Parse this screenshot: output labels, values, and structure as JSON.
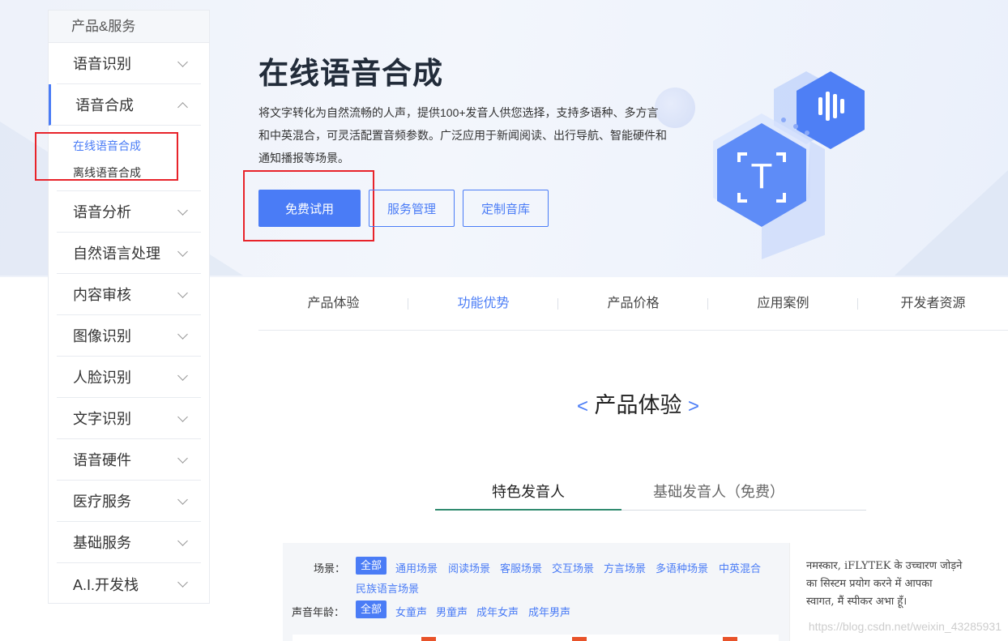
{
  "sidebar": {
    "header": "产品&服务",
    "items_top": [
      {
        "label": "语音识别"
      }
    ],
    "active_item": {
      "label": "语音合成"
    },
    "sub_items": [
      {
        "label": "在线语音合成"
      },
      {
        "label": "离线语音合成"
      }
    ],
    "items_bottom": [
      {
        "label": "语音分析"
      },
      {
        "label": "自然语言处理"
      },
      {
        "label": "内容审核"
      },
      {
        "label": "图像识别"
      },
      {
        "label": "人脸识别"
      },
      {
        "label": "文字识别"
      },
      {
        "label": "语音硬件"
      },
      {
        "label": "医疗服务"
      },
      {
        "label": "基础服务"
      },
      {
        "label": "A.I.开发栈"
      }
    ]
  },
  "hero": {
    "title": "在线语音合成",
    "description": "将文字转化为自然流畅的人声，提供100+发音人供您选择，支持多语种、多方言和中英混合，可灵活配置音频参数。广泛应用于新闻阅读、出行导航、智能硬件和通知播报等场景。",
    "buttons": {
      "try": "免费试用",
      "manage": "服务管理",
      "custom": "定制音库"
    },
    "illustration_letter": "T"
  },
  "nav_tabs": [
    "产品体验",
    "功能优势",
    "产品价格",
    "应用案例",
    "开发者资源"
  ],
  "nav_active_index": 1,
  "section": {
    "left_bracket": "<",
    "title": "产品体验",
    "right_bracket": ">"
  },
  "voice_tabs": {
    "featured": "特色发音人",
    "basic": "基础发音人（免费）"
  },
  "filters": {
    "scene_label": "场景：",
    "scene_chips": [
      "全部",
      "通用场景",
      "阅读场景",
      "客服场景",
      "交互场景",
      "方言场景",
      "多语种场景",
      "中英混合",
      "民族语言场景"
    ],
    "age_label": "声音年龄：",
    "age_chips": [
      "全部",
      "女童声",
      "男童声",
      "成年女声",
      "成年男声"
    ]
  },
  "text_panel": {
    "line1": "नमस्कार, iFLYTEK के उच्चारण जोड़ने",
    "line2": "का सिस्टम प्रयोग करने में आपका",
    "line3": "स्वागत, मैं स्पीकर अभा हूँ।"
  },
  "watermark": "https://blog.csdn.net/weixin_43285931",
  "colors": {
    "accent": "#4a7cf6",
    "annotation": "#e8232a",
    "tab_underline": "#2f8b6e"
  }
}
